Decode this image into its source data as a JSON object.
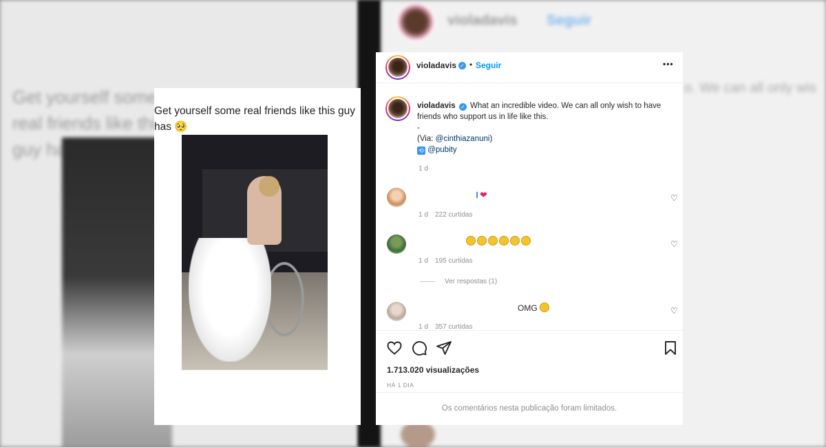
{
  "background": {
    "left_text": "Get yourself some real friends like this guy has",
    "right_username": "violadavis",
    "right_follow": "Seguir",
    "right_text": "o. We can all only wis"
  },
  "tweet": {
    "text": "Get yourself some real friends like this guy has 🥺"
  },
  "instagram": {
    "header": {
      "username": "violadavis",
      "separator": "•",
      "follow_label": "Seguir",
      "more_label": "•••"
    },
    "caption": {
      "username": "violadavis",
      "text": "What an incredible video. We can all only wish to have friends who support us in life like this.",
      "dash": "-",
      "via_prefix": "(Via: ",
      "via_handle": "@cinthiazanuni",
      "via_suffix": ")",
      "repost_handle": "@pubity",
      "time": "1 d"
    },
    "comments": [
      {
        "time": "1 d",
        "likes": "222 curtidas"
      },
      {
        "time": "1 d",
        "likes": "195 curtidas"
      },
      {
        "text": "OMG",
        "time": "1 d",
        "likes": "357 curtidas"
      }
    ],
    "view_replies": "Ver respostas (1)",
    "views": "1.713.020 visualizações",
    "ago": "HÁ 1 DIA",
    "limited": "Os comentários nesta publicação foram limitados."
  },
  "colors": {
    "accent": "#0095f6",
    "verified": "#3897f0",
    "muted": "#8e8e8e",
    "heart_red": "#e0245e"
  }
}
